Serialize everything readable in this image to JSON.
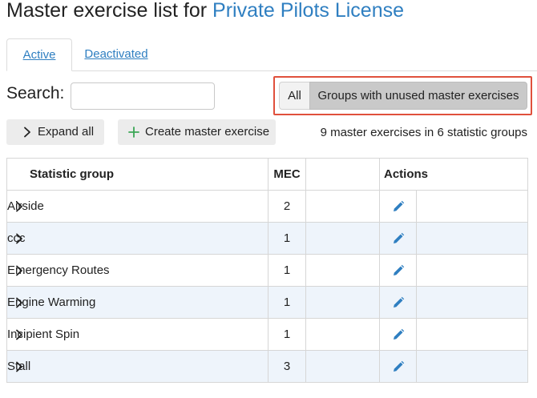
{
  "header": {
    "title_prefix": "Master exercise list for",
    "course_name": "Private Pilots License"
  },
  "tabs": [
    {
      "label": "Active",
      "active": true
    },
    {
      "label": "Deactivated",
      "active": false
    }
  ],
  "search": {
    "label": "Search:",
    "value": ""
  },
  "filter": {
    "all_label": "All",
    "groups_label": "Groups with unused master exercises",
    "selected": "Groups with unused master exercises",
    "highlight_color": "#e0503c"
  },
  "toolbar": {
    "expand_label": "Expand all",
    "create_label": "Create master exercise",
    "summary": "9 master exercises in 6 statistic groups"
  },
  "table": {
    "headers": {
      "group": "Statistic group",
      "mec": "MEC",
      "actions": "Actions"
    },
    "rows": [
      {
        "group": "Airside",
        "mec": "2"
      },
      {
        "group": "ccc",
        "mec": "1"
      },
      {
        "group": "Emergency Routes",
        "mec": "1"
      },
      {
        "group": "Engine Warming",
        "mec": "1"
      },
      {
        "group": "Incipient Spin",
        "mec": "1"
      },
      {
        "group": "Stall",
        "mec": "3"
      }
    ]
  },
  "icons": {
    "chevron": "chevron-right-icon",
    "plus": "plus-icon",
    "edit": "pencil-icon"
  },
  "colors": {
    "link": "#2f7fc1",
    "plus": "#3aa655",
    "edit_icon": "#2f7fc1",
    "alt_row": "#eef4fb"
  }
}
